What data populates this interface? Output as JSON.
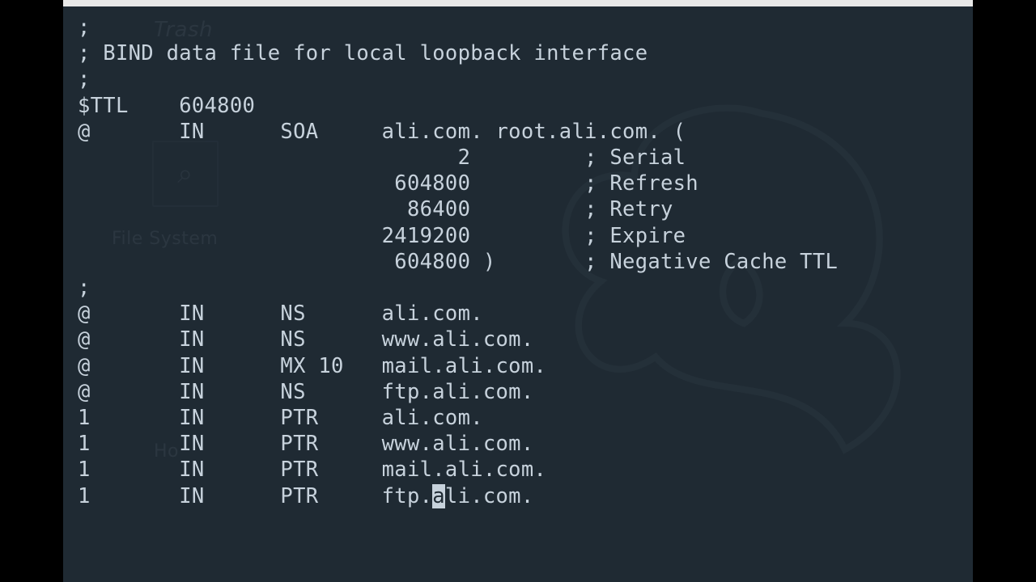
{
  "desktop": {
    "trash_label": "Trash",
    "fs_label": "File System",
    "home_label_fragment": "Ho",
    "magnifier_glyph": "⌕"
  },
  "terminal": {
    "lines": [
      ";",
      "; BIND data file for local loopback interface",
      ";",
      "$TTL    604800",
      "@       IN      SOA     ali.com. root.ali.com. (",
      "                              2         ; Serial",
      "                         604800         ; Refresh",
      "                          86400         ; Retry",
      "                        2419200         ; Expire",
      "                         604800 )       ; Negative Cache TTL",
      ";",
      "@       IN      NS      ali.com.",
      "@       IN      NS      www.ali.com.",
      "@       IN      MX 10   mail.ali.com.",
      "@       IN      NS      ftp.ali.com.",
      "1       IN      PTR     ali.com.",
      "1       IN      PTR     www.ali.com.",
      "1       IN      PTR     mail.ali.com."
    ],
    "cursor_line": {
      "prefix": "1       IN      PTR     ftp.",
      "cursor_char": "a",
      "suffix": "li.com."
    }
  }
}
